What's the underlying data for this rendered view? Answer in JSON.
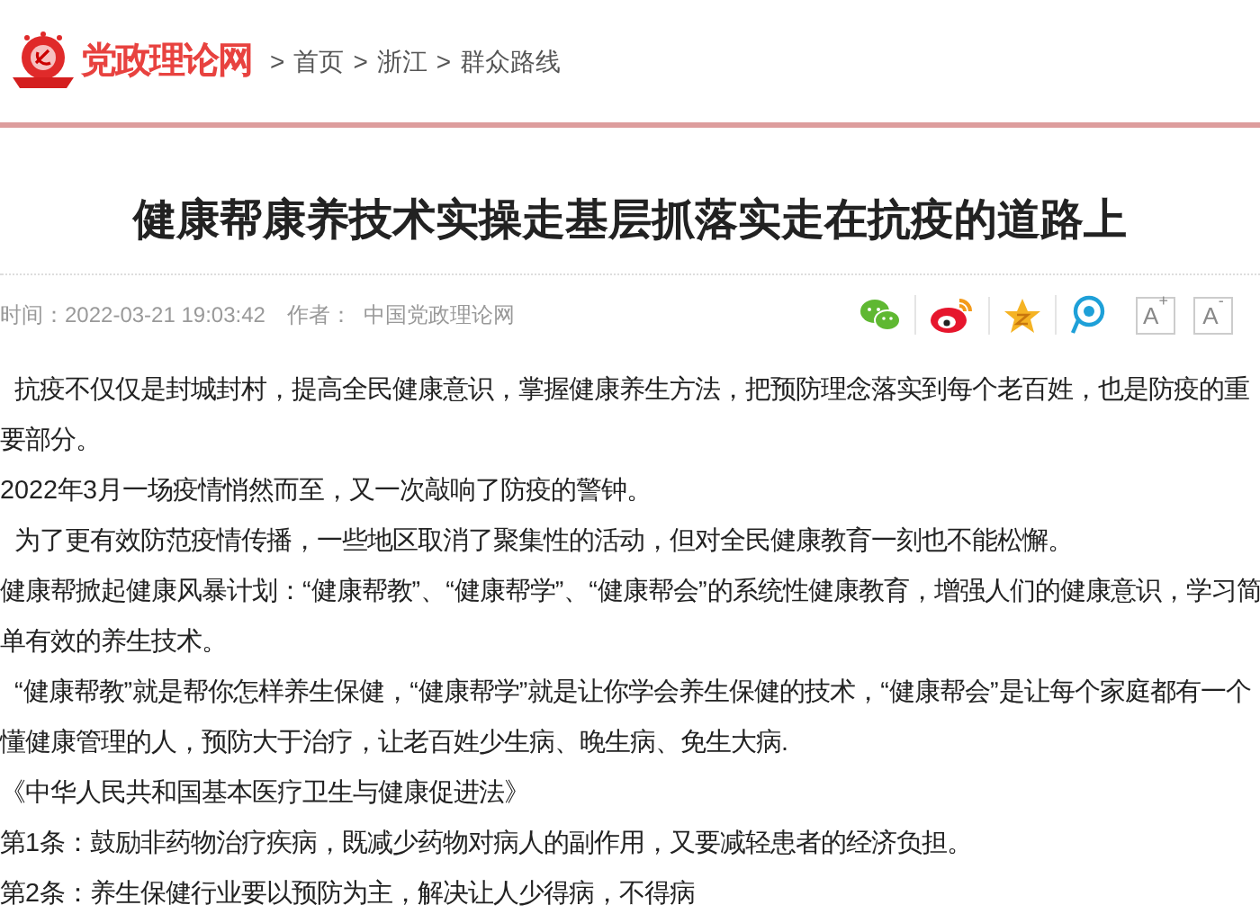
{
  "header": {
    "site_name": "党政理论网",
    "breadcrumb": [
      {
        "separator": ">",
        "label": "首页"
      },
      {
        "separator": ">",
        "label": "浙江"
      },
      {
        "separator": ">",
        "label": "群众路线"
      }
    ]
  },
  "article": {
    "title": "健康帮康养技术实操走基层抓落实走在抗疫的道路上",
    "meta": {
      "time": "时间：2022-03-21 19:03:42",
      "author": "作者：  中国党政理论网"
    },
    "share": [
      {
        "kind": "wechat"
      },
      {
        "kind": "weibo"
      },
      {
        "kind": "qzone"
      },
      {
        "kind": "tqq"
      }
    ],
    "font_buttons": [
      {
        "letter": "A",
        "sign": "+"
      },
      {
        "letter": "A",
        "sign": "-"
      }
    ],
    "paragraphs": [
      {
        "text": "抗疫不仅仅是封城封村，提高全民健康意识，掌握健康养生方法，把预防理念落实到每个老百姓，也是防疫的重要部分。",
        "indent": true
      },
      {
        "text": "2022年3月一场疫情悄然而至，又一次敲响了防疫的警钟。",
        "indent": false
      },
      {
        "text": "为了更有效防范疫情传播，一些地区取消了聚集性的活动，但对全民健康教育一刻也不能松懈。",
        "indent": true
      },
      {
        "text": "健康帮掀起健康风暴计划：“健康帮教”、“健康帮学”、“健康帮会”的系统性健康教育，增强人们的健康意识，学习简单有效的养生技术。",
        "indent": false
      },
      {
        "text": "“健康帮教”就是帮你怎样养生保健，“健康帮学”就是让你学会养生保健的技术，“健康帮会”是让每个家庭都有一个懂健康管理的人，预防大于治疗，让老百姓少生病、晚生病、免生大病.",
        "indent": true
      },
      {
        "text": "《中华人民共和国基本医疗卫生与健康促进法》",
        "indent": false
      },
      {
        "text": "第1条：鼓励非药物治疗疾病，既减少药物对病人的副作用，又要减轻患者的经济负担。",
        "indent": false
      },
      {
        "text": "第2条：养生保健行业要以预防为主，解决让人少得病，不得病",
        "indent": false
      }
    ]
  }
}
